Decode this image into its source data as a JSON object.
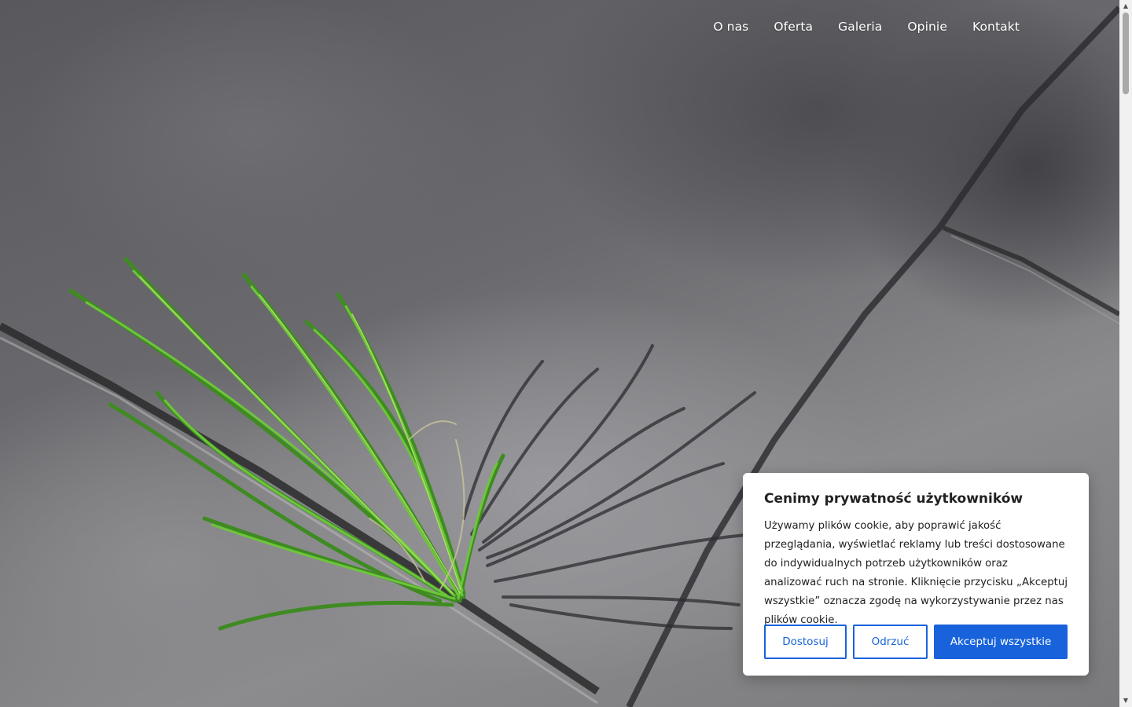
{
  "nav": {
    "items": [
      {
        "label": "O nas"
      },
      {
        "label": "Oferta"
      },
      {
        "label": "Galeria"
      },
      {
        "label": "Opinie"
      },
      {
        "label": "Kontakt"
      }
    ]
  },
  "hero": {
    "image": "grass-tuft-growing-between-paving-stones"
  },
  "cookie_banner": {
    "title": "Cenimy prywatność użytkowników",
    "text": "Używamy plików cookie, aby poprawić jakość przeglądania, wyświetlać reklamy lub treści dostosowane do indywidualnych potrzeb użytkowników oraz analizować ruch na stronie. Kliknięcie przycisku „Akceptuj wszystkie” oznacza zgodę na wykorzystywanie przez nas plików cookie.",
    "buttons": {
      "customize": "Dostosuj",
      "reject": "Odrzuć",
      "accept": "Akceptuj wszystkie"
    }
  },
  "colors": {
    "accent": "#1863dc",
    "nav_text": "#ffffff",
    "banner_bg": "#ffffff",
    "banner_text": "#212121"
  },
  "scrollbar": {
    "up_icon": "scroll-up-arrow-icon",
    "down_icon": "scroll-down-arrow-icon"
  }
}
